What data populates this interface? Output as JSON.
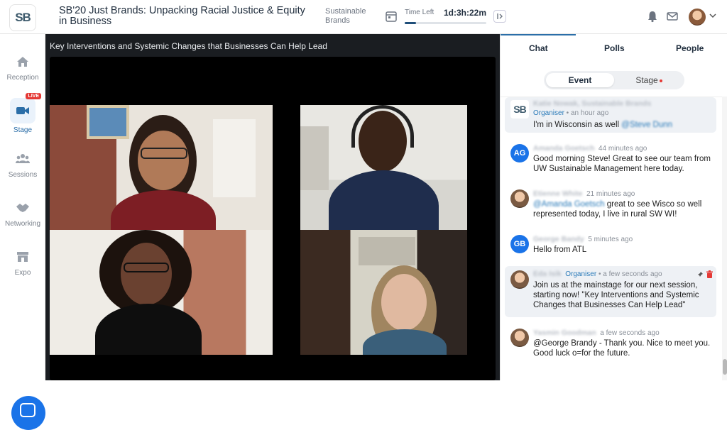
{
  "header": {
    "logo_text": "SB",
    "event_title": "SB'20 Just Brands: Unpacking Racial Justice & Equity in Business",
    "organizer": "Sustainable Brands",
    "time_left_label": "Time Left",
    "time_left_value": "1d:3h:22m",
    "time_progress": 0.14
  },
  "nav": {
    "items": [
      {
        "label": "Reception",
        "icon": "home-icon"
      },
      {
        "label": "Stage",
        "icon": "video-camera-icon",
        "active": true,
        "badge": "LIVE"
      },
      {
        "label": "Sessions",
        "icon": "people-group-icon"
      },
      {
        "label": "Networking",
        "icon": "handshake-icon"
      },
      {
        "label": "Expo",
        "icon": "storefront-icon"
      }
    ]
  },
  "stage": {
    "session_title": "Key Interventions and Systemic Changes that Businesses Can Help Lead"
  },
  "panel": {
    "tabs": [
      "Chat",
      "Polls",
      "People"
    ],
    "active_tab": "Chat",
    "segments": [
      "Event",
      "Stage"
    ],
    "messages": [
      {
        "initials": "SB",
        "name": "Katie Nowak, Sustainable Brands",
        "role": "Organiser",
        "time": "an hour ago",
        "text": "I'm in Wisconsin as well ",
        "mention": "@Steve Dunn"
      },
      {
        "initials": "AG",
        "name": "Amanda Goetsch",
        "time": "44 minutes ago",
        "text": "Good morning Steve! Great to see our team from UW Sustainable Management here today."
      },
      {
        "initials": "",
        "name": "Etienne White",
        "time": "21 minutes ago",
        "mention": "@Amanda Goetsch",
        "text": " great to see Wisco so well represented today, I live in rural SW WI!"
      },
      {
        "initials": "GB",
        "name": "George Bandy",
        "time": "5 minutes ago",
        "text": "Hello from ATL"
      },
      {
        "initials": "",
        "name": "Eda Isik",
        "role": "Organiser",
        "time": "a few seconds ago",
        "text": "Join us at the mainstage for our next session, starting now! \"Key Interventions and Systemic Changes that Businesses Can Help Lead\""
      },
      {
        "initials": "",
        "name": "Yasmin Goodman",
        "time": "a few seconds ago",
        "text": "@George Brandy - Thank you. Nice to meet you. Good luck o=for the future."
      }
    ]
  },
  "colors": {
    "accent": "#2b6ea8",
    "live": "#e53935",
    "ag_avatar": "#1a73e8",
    "gb_avatar": "#1a73e8"
  }
}
